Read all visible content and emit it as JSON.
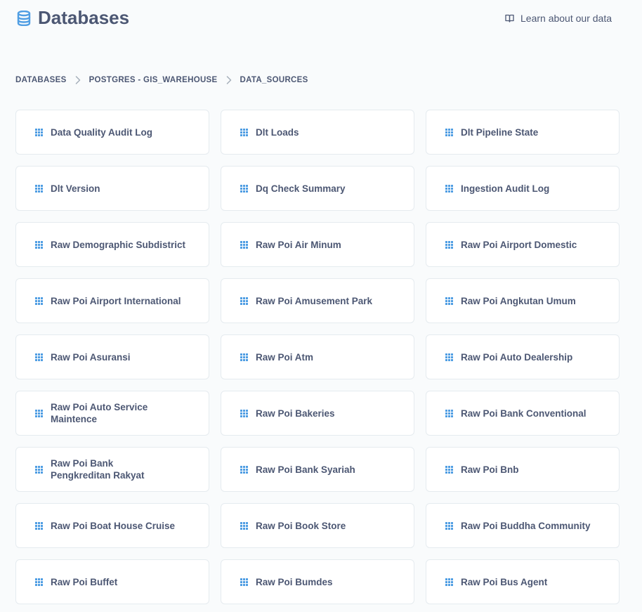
{
  "header": {
    "title": "Databases",
    "learn_link": "Learn about our data",
    "icons": {
      "title_icon": "database-icon",
      "link_icon": "book-icon"
    }
  },
  "breadcrumb": {
    "items": [
      "DATABASES",
      "POSTGRES - GIS_WAREHOUSE",
      "DATA_SOURCES"
    ],
    "separator_icon": "chevron-right-icon"
  },
  "tables": [
    "Data Quality Audit Log",
    "Dlt Loads",
    "Dlt Pipeline State",
    "Dlt Version",
    "Dq Check Summary",
    "Ingestion Audit Log",
    "Raw Demographic Subdistrict",
    "Raw Poi Air Minum",
    "Raw Poi Airport Domestic",
    "Raw Poi Airport International",
    "Raw Poi Amusement Park",
    "Raw Poi Angkutan Umum",
    "Raw Poi Asuransi",
    "Raw Poi Atm",
    "Raw Poi Auto Dealership",
    "Raw Poi Auto Service Maintence",
    "Raw Poi Bakeries",
    "Raw Poi Bank Conventional",
    "Raw Poi Bank Pengkreditan Rakyat",
    "Raw Poi Bank Syariah",
    "Raw Poi Bnb",
    "Raw Poi Boat House Cruise",
    "Raw Poi Book Store",
    "Raw Poi Buddha Community",
    "Raw Poi Buffet",
    "Raw Poi Bumdes",
    "Raw Poi Bus Agent"
  ],
  "table_icon": "table-grid-icon",
  "colors": {
    "text": "#4c5773",
    "brand": "#509ee3",
    "card_border": "#e5ebef",
    "background": "#f9fbfc"
  }
}
